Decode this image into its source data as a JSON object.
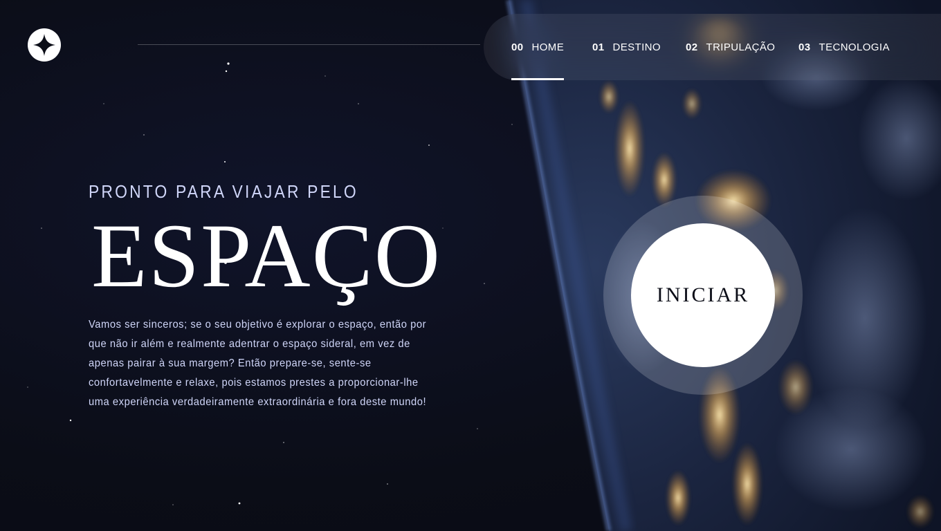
{
  "brand": {
    "logo_icon": "four-point-star-icon"
  },
  "nav": {
    "items": [
      {
        "number": "00",
        "label": "HOME",
        "active": true
      },
      {
        "number": "01",
        "label": "DESTINO",
        "active": false
      },
      {
        "number": "02",
        "label": "TRIPULAÇÃO",
        "active": false
      },
      {
        "number": "03",
        "label": "TECNOLOGIA",
        "active": false
      }
    ]
  },
  "hero": {
    "eyebrow": "PRONTO PARA VIAJAR PELO",
    "title": "ESPAÇO",
    "body": "Vamos ser sinceros; se o seu objetivo é explorar o espaço, então por que não ir além e realmente adentrar o espaço sideral, em vez de apenas pairar à sua margem? Então prepare-se, sente-se confortavelmente e relaxe, pois estamos prestes a proporcionar-lhe uma experiência verdadeiramente extraordinária e fora deste mundo!"
  },
  "cta": {
    "label": "INICIAR"
  },
  "colors": {
    "background": "#0b0d17",
    "text_light": "#d0d6f9",
    "white": "#ffffff"
  }
}
